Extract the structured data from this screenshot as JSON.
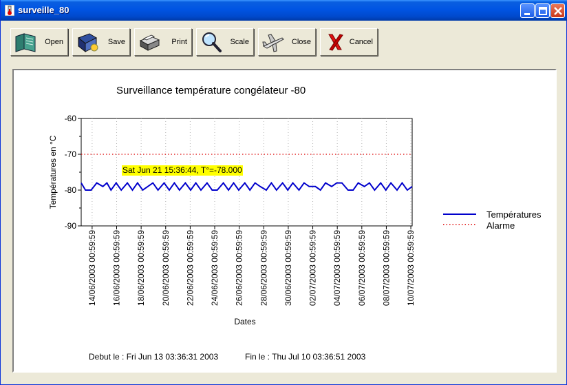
{
  "window": {
    "title": "surveille_80"
  },
  "toolbar": {
    "buttons": [
      {
        "label": "Open",
        "icon": "open-book-icon"
      },
      {
        "label": "Save",
        "icon": "save-disk-icon"
      },
      {
        "label": "Print",
        "icon": "printer-icon"
      },
      {
        "label": "Scale",
        "icon": "magnifier-icon"
      },
      {
        "label": "Close",
        "icon": "airplane-icon"
      },
      {
        "label": "Cancel",
        "icon": "red-x-icon"
      }
    ]
  },
  "colors": {
    "series": "#0000cc",
    "alarm": "#dd0000",
    "tooltip": "#ffff00"
  },
  "tooltip": {
    "text": "Sat Jun 21 15:36:44, T°=-78.000"
  },
  "footer": {
    "start": "Debut le : Fri Jun 13 03:36:31 2003",
    "end": "Fin le : Thu Jul 10 03:36:51 2003"
  },
  "chart_data": {
    "type": "line",
    "title": "Surveillance température congélateur -80",
    "xlabel": "Dates",
    "ylabel": "Températures en °C",
    "ylim": [
      -90,
      -60
    ],
    "xlim": [
      "13/06/2003 03:36:31",
      "10/07/2003 03:36:51"
    ],
    "yticks": [
      -60,
      -70,
      -80,
      -90
    ],
    "xticks": [
      "14/06/2003 00:59:59",
      "16/06/2003 00:59:59",
      "18/06/2003 00:59:59",
      "20/06/2003 00:59:59",
      "22/06/2003 00:59:59",
      "24/06/2003 00:59:59",
      "26/06/2003 00:59:59",
      "28/06/2003 00:59:59",
      "30/06/2003 00:59:59",
      "02/07/2003 00:59:59",
      "04/07/2003 00:59:59",
      "06/07/2003 00:59:59",
      "08/07/2003 00:59:59",
      "10/07/2003 00:59:59"
    ],
    "grid": "vertical dotted",
    "legend": "right",
    "series": [
      {
        "name": "Températures",
        "style": "solid",
        "x": [
          "13/06/2003 03:36",
          "13/06/2003 12:00",
          "13/06/2003 23:00",
          "14/06/2003 10:00",
          "14/06/2003 22:00",
          "15/06/2003 06:00",
          "15/06/2003 14:00",
          "16/06/2003 00:00",
          "16/06/2003 10:00",
          "16/06/2003 22:00",
          "17/06/2003 08:00",
          "17/06/2003 18:00",
          "18/06/2003 04:00",
          "18/06/2003 14:00",
          "19/06/2003 00:00",
          "19/06/2003 10:00",
          "19/06/2003 22:00",
          "20/06/2003 08:00",
          "20/06/2003 18:00",
          "21/06/2003 04:00",
          "21/06/2003 15:36",
          "22/06/2003 02:00",
          "22/06/2003 12:00",
          "22/06/2003 22:00",
          "23/06/2003 10:00",
          "23/06/2003 20:00",
          "24/06/2003 06:00",
          "24/06/2003 18:00",
          "25/06/2003 04:00",
          "25/06/2003 14:00",
          "26/06/2003 00:00",
          "26/06/2003 12:00",
          "26/06/2003 22:00",
          "27/06/2003 08:00",
          "27/06/2003 18:00",
          "28/06/2003 06:00",
          "28/06/2003 16:00",
          "29/06/2003 02:00",
          "29/06/2003 14:00",
          "30/06/2003 00:00",
          "30/06/2003 10:00",
          "30/06/2003 22:00",
          "01/07/2003 08:00",
          "01/07/2003 18:00",
          "02/07/2003 06:00",
          "02/07/2003 16:00",
          "03/07/2003 02:00",
          "03/07/2003 14:00",
          "04/07/2003 00:00",
          "04/07/2003 10:00",
          "04/07/2003 22:00",
          "05/07/2003 08:00",
          "05/07/2003 18:00",
          "06/07/2003 06:00",
          "06/07/2003 16:00",
          "07/07/2003 02:00",
          "07/07/2003 14:00",
          "08/07/2003 00:00",
          "08/07/2003 10:00",
          "08/07/2003 22:00",
          "09/07/2003 08:00",
          "09/07/2003 18:00",
          "10/07/2003 03:36"
        ],
        "y": [
          -78,
          -80,
          -80,
          -78,
          -79,
          -78,
          -80,
          -78,
          -80,
          -78,
          -80,
          -78,
          -80,
          -79,
          -78,
          -80,
          -78,
          -80,
          -78,
          -80,
          -78,
          -80,
          -78,
          -80,
          -78,
          -80,
          -80,
          -78,
          -80,
          -78,
          -80,
          -78,
          -80,
          -78,
          -79,
          -80,
          -78,
          -80,
          -78,
          -80,
          -78,
          -80,
          -78,
          -79,
          -79,
          -80,
          -78,
          -79,
          -78,
          -78,
          -80,
          -80,
          -78,
          -79,
          -78,
          -80,
          -78,
          -80,
          -78,
          -80,
          -78,
          -80,
          -79
        ]
      },
      {
        "name": "Alarme",
        "style": "dotted",
        "x": [
          "13/06/2003 03:36:31",
          "10/07/2003 03:36:51"
        ],
        "y": [
          -70,
          -70
        ]
      }
    ]
  }
}
